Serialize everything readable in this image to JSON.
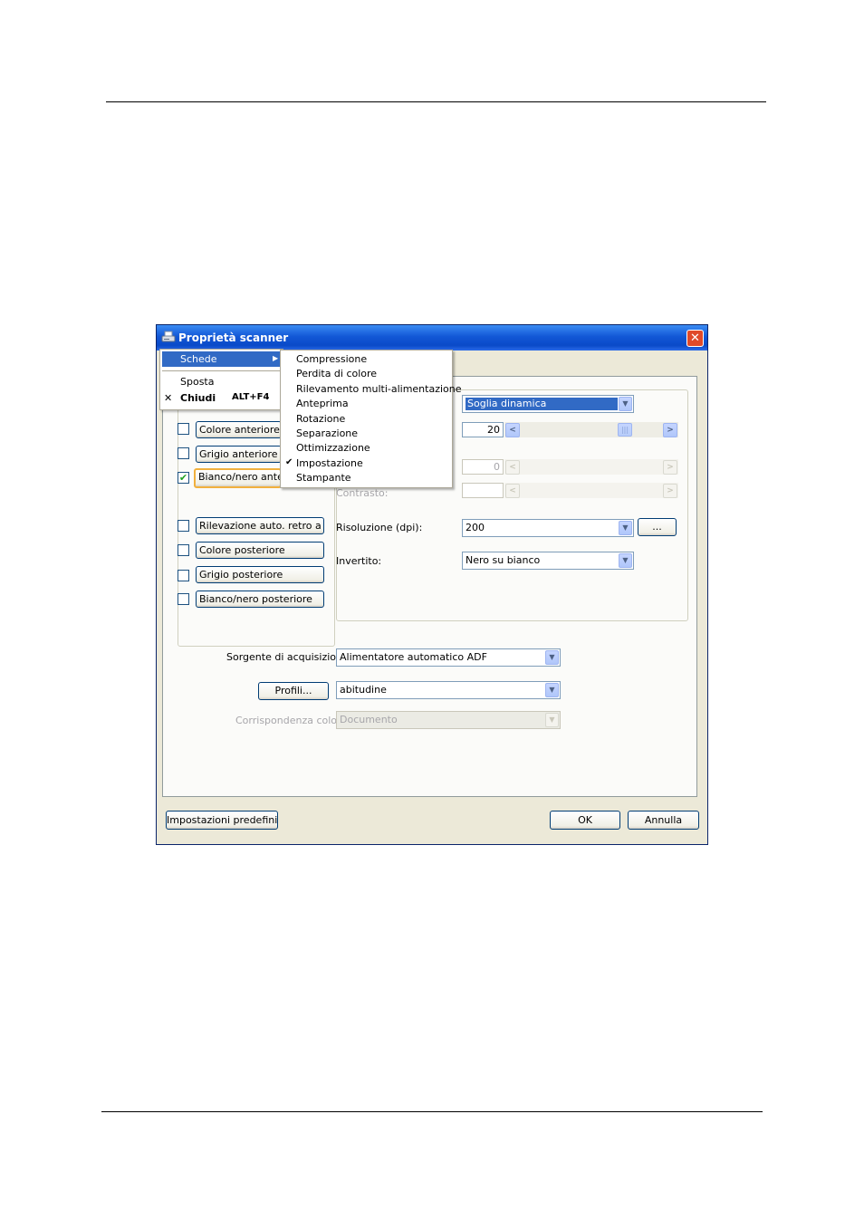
{
  "window": {
    "title": "Proprietà scanner",
    "close_glyph": "✕"
  },
  "system_menu": {
    "items": [
      {
        "label": "Schede"
      },
      {
        "label": "Sposta"
      },
      {
        "label": "Chiudi",
        "shortcut": "ALT+F4"
      }
    ],
    "close_glyph": "✕",
    "submenu_arrow": "▶"
  },
  "tabs_submenu": {
    "items": [
      "Compressione",
      "Perdita di colore",
      "Rilevamento multi-alimentazione",
      "Anteprima",
      "Rotazione",
      "Separazione",
      "Ottimizzazione",
      "Impostazione",
      "Stampante"
    ],
    "checked_item": "Impostazione",
    "check_glyph": "✔"
  },
  "image_selection": {
    "items": [
      {
        "label": "Colore anteriore",
        "checked": false
      },
      {
        "label": "Grigio anteriore",
        "checked": false
      },
      {
        "label": "Bianco/nero anterio",
        "checked": true
      },
      {
        "label": "Rilevazione auto. retro a color",
        "checked": false
      },
      {
        "label": "Colore posteriore",
        "checked": false
      },
      {
        "label": "Grigio posteriore",
        "checked": false
      },
      {
        "label": "Bianco/nero posteriore",
        "checked": false
      }
    ],
    "check_glyph": "✔"
  },
  "settings": {
    "binarization": {
      "value": "Soglia dinamica"
    },
    "threshold": {
      "value": "20",
      "level": 0.76
    },
    "brightness": {
      "value": "0"
    },
    "contrast": {
      "label": "Contrasto:"
    },
    "resolution": {
      "label": "Risoluzione (dpi):",
      "value": "200",
      "more_button": "..."
    },
    "invert": {
      "label": "Invertito:",
      "value": "Nero su bianco"
    }
  },
  "source": {
    "label": "Sorgente di acquisizione:",
    "value": "Alimentatore automatico ADF"
  },
  "profiles": {
    "button": "Profili...",
    "value": "abitudine"
  },
  "color_matching": {
    "label": "Corrispondenza colore:",
    "value": "Documento"
  },
  "footer": {
    "defaults_button": "Impostazioni predefinite",
    "ok_button": "OK",
    "cancel_button": "Annulla"
  },
  "glyphs": {
    "dropdown": "▼",
    "left": "<",
    "right": ">",
    "thumb": "|||"
  }
}
